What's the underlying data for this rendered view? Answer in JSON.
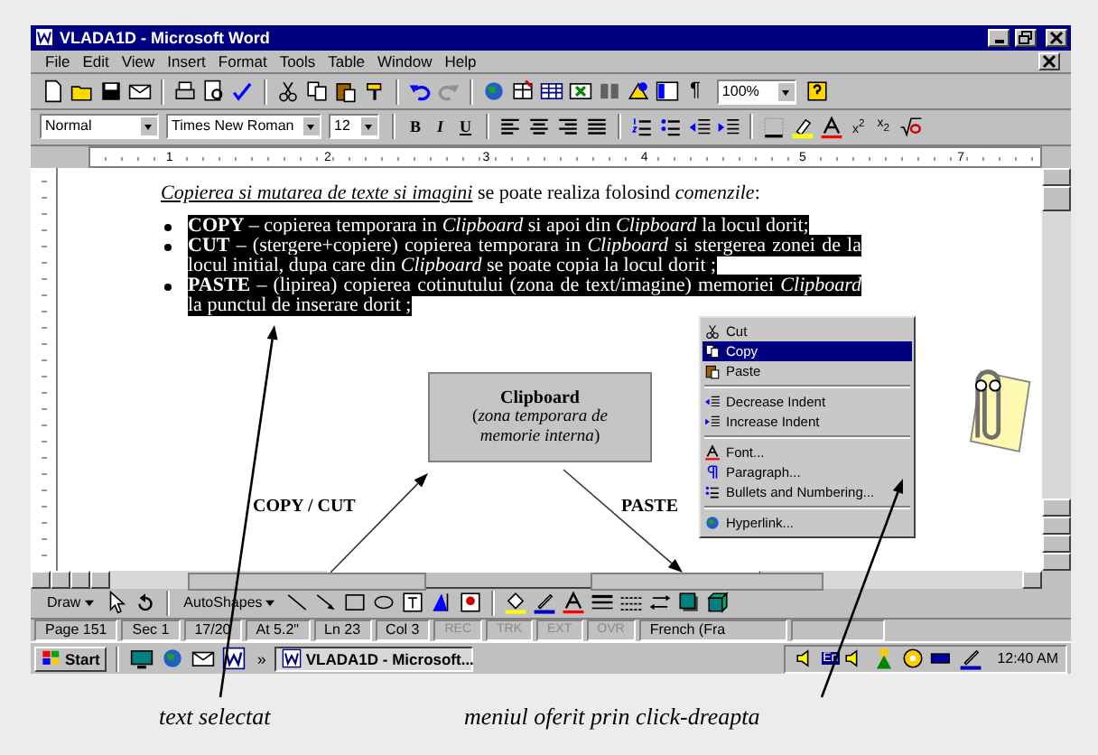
{
  "window": {
    "title": "VLADA1D - Microsoft Word"
  },
  "menu_bar": [
    "File",
    "Edit",
    "View",
    "Insert",
    "Format",
    "Tools",
    "Table",
    "Window",
    "Help"
  ],
  "standard_toolbar": {
    "show_formatting": "¶",
    "zoom": "100%"
  },
  "formatting_toolbar": {
    "style": "Normal",
    "font": "Times New Roman",
    "size": "12",
    "bold": "B",
    "italic": "I",
    "underline": "U",
    "superscript": "x$^{2}$",
    "subscript": "x$_{2}$"
  },
  "ruler": {
    "numbers": [
      "1",
      "2",
      "3",
      "4",
      "5",
      "7"
    ]
  },
  "document": {
    "intro_underlined": "Copierea si mutarea de texte si imagini",
    "intro_rest": " se poate realiza folosind *comenzile*:",
    "bullets": [
      {
        "text": "**COPY** – copierea temporara in *Clipboard* si apoi din *Clipboard* la locul dorit;",
        "selected": true
      },
      {
        "text": "**CUT** – (stergere+copiere) copierea temporara in *Clipboard* si stergerea zonei de la locul initial, dupa care din *Clipboard* se poate copia la locul dorit ;",
        "selected": true
      },
      {
        "text": "**PASTE** – (lipirea) copierea cotinutului (zona de text/imagine) memoriei *Clipboard* la punctul de inserare dorit ;",
        "selected": true
      }
    ]
  },
  "diagram": {
    "box_title": "Clipboard",
    "box_subtitle": "(*zona temporara de memorie interna*)",
    "copy_label": "COPY / CUT",
    "paste_label": "PASTE"
  },
  "context_menu": {
    "groups": [
      [
        {
          "label": "Cut",
          "selected": false
        },
        {
          "label": "Copy",
          "selected": true
        },
        {
          "label": "Paste",
          "selected": false
        }
      ],
      [
        {
          "label": "Decrease Indent",
          "selected": false
        },
        {
          "label": "Increase Indent",
          "selected": false
        }
      ],
      [
        {
          "label": "Font...",
          "selected": false
        },
        {
          "label": "Paragraph...",
          "selected": false
        },
        {
          "label": "Bullets and Numbering...",
          "selected": false
        }
      ],
      [
        {
          "label": "Hyperlink...",
          "selected": false
        }
      ]
    ]
  },
  "drawing_toolbar": {
    "draw": "Draw",
    "autoshapes": "AutoShapes"
  },
  "status_bar": {
    "fields": [
      "Page 151",
      "Sec 1",
      "17/20",
      "At 5.2\"",
      "Ln 23",
      "Col 3"
    ],
    "modes": [
      {
        "label": "REC",
        "disabled": true
      },
      {
        "label": "TRK",
        "disabled": true
      },
      {
        "label": "EXT",
        "disabled": true
      },
      {
        "label": "OVR",
        "disabled": true
      }
    ],
    "language": "French (Fra"
  },
  "taskbar": {
    "start": "Start",
    "more": "»",
    "task": "VLADA1D - Microsoft...",
    "tray_language": "En",
    "clock": "12:40 AM"
  },
  "captions": [
    "text selectat",
    "meniul oferit prin click-dreapta"
  ]
}
